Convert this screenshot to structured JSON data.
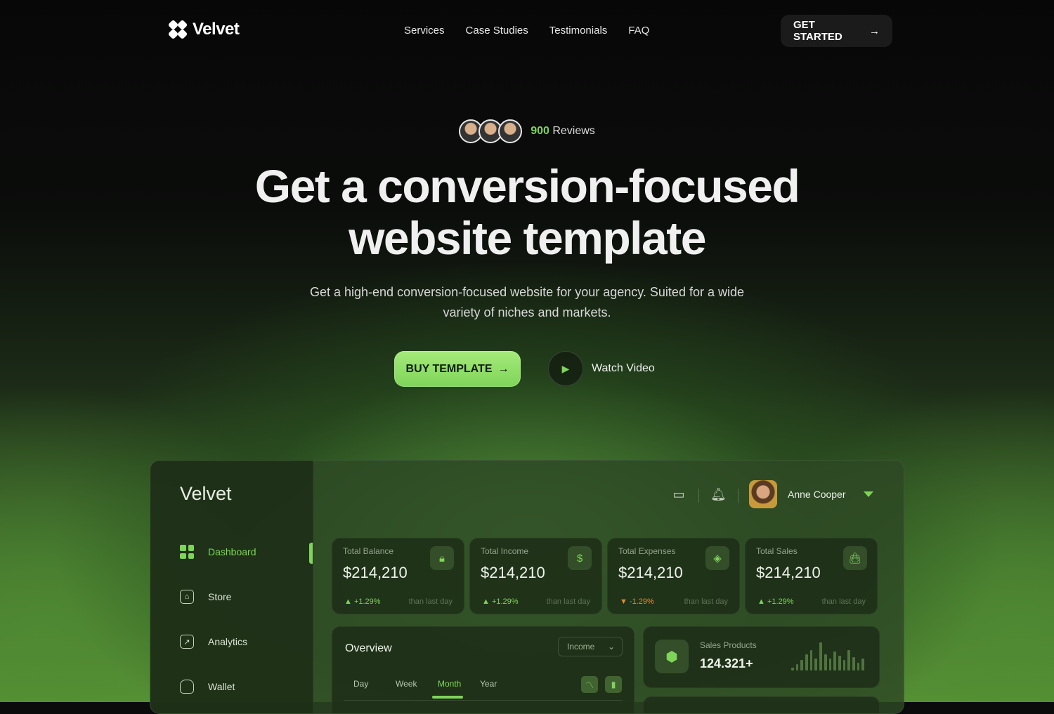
{
  "nav": {
    "brand": "Velvet",
    "links": [
      "Services",
      "Case Studies",
      "Testimonials",
      "FAQ"
    ],
    "cta": "GET STARTED"
  },
  "hero": {
    "reviews_count": "900",
    "reviews_label": "Reviews",
    "headline_line1": "Get a conversion-focused",
    "headline_line2": "website template",
    "subtitle": "Get a high-end conversion-focused website for your agency. Suited for a wide variety of niches and markets.",
    "buy_label": "BUY TEMPLATE",
    "watch_label": "Watch Video"
  },
  "dashboard": {
    "brand": "Velvet",
    "sidebar": [
      {
        "label": "Dashboard",
        "icon": "grid-icon",
        "active": true
      },
      {
        "label": "Store",
        "icon": "store-icon"
      },
      {
        "label": "Analytics",
        "icon": "analytics-icon"
      },
      {
        "label": "Wallet",
        "icon": "wallet-icon"
      }
    ],
    "user": {
      "name": "Anne Cooper"
    },
    "cards": [
      {
        "title": "Total Balance",
        "value": "$214,210",
        "change": "+1.29%",
        "trend": "up",
        "note": "than last day",
        "icon": "wallet-lock-icon"
      },
      {
        "title": "Total Income",
        "value": "$214,210",
        "change": "+1.29%",
        "trend": "up",
        "note": "than last day",
        "icon": "coin-icon"
      },
      {
        "title": "Total Expenses",
        "value": "$214,210",
        "change": "-1.29%",
        "trend": "down",
        "note": "than last day",
        "icon": "tag-icon"
      },
      {
        "title": "Total Sales",
        "value": "$214,210",
        "change": "+1.29%",
        "trend": "up",
        "note": "than last day",
        "icon": "bag-icon"
      }
    ],
    "overview": {
      "title": "Overview",
      "select": "Income",
      "tabs": [
        "Day",
        "Week",
        "Month",
        "Year"
      ],
      "active_tab": "Month"
    },
    "sales_products": {
      "title": "Sales Products",
      "value": "124.321+",
      "bars": [
        4,
        9,
        14,
        22,
        28,
        16,
        38,
        22,
        16,
        26,
        20,
        14,
        28,
        18,
        10,
        16
      ]
    },
    "colors": {
      "accent": "#7fd45a",
      "down": "#e38b2e"
    }
  }
}
